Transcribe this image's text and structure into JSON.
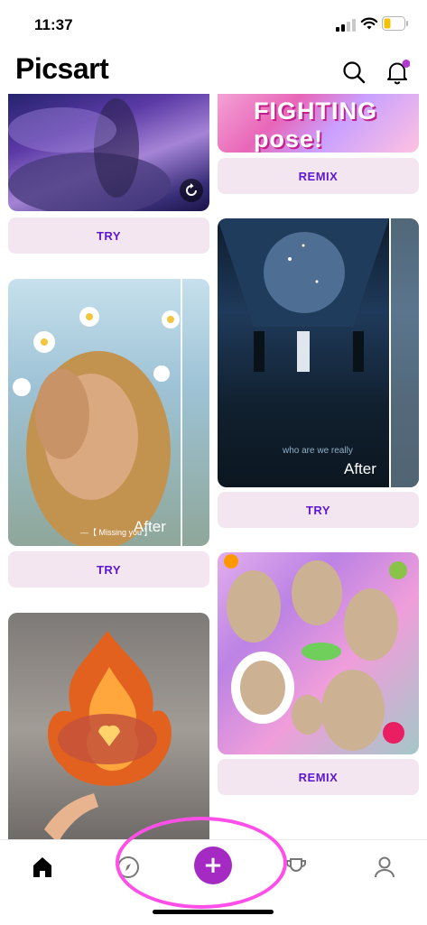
{
  "status_bar": {
    "time": "11:37"
  },
  "header": {
    "logo": "Picsart"
  },
  "feed": {
    "cards": [
      {
        "column": "left",
        "button": "TRY"
      },
      {
        "column": "right",
        "overlay_text": "FIGHTING pose!",
        "button": "REMIX"
      },
      {
        "column": "left",
        "after_label": "After",
        "caption": "—【 Missing you 】",
        "button": "TRY"
      },
      {
        "column": "right",
        "after_label": "After",
        "caption": "who are we really",
        "button": "TRY"
      },
      {
        "column": "right",
        "button": "REMIX"
      },
      {
        "column": "left"
      }
    ]
  },
  "tabbar": {
    "items": [
      "home-icon",
      "discover-icon",
      "create-button",
      "challenges-icon",
      "profile-icon"
    ],
    "accent": "#a52ac4"
  },
  "colors": {
    "button_bg": "#f3e6f0",
    "button_text": "#5b17d3",
    "annotation": "#ff4fe6",
    "notification_dot": "#b03ad0"
  }
}
